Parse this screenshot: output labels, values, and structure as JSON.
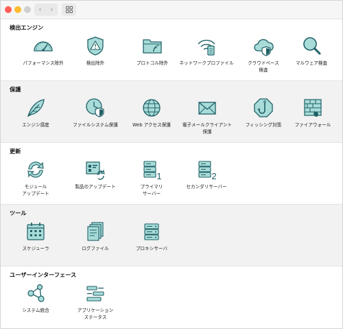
{
  "colors": {
    "icon_fill": "#a9dcd9",
    "icon_stroke": "#1f5f66",
    "section_alt_bg": "#f2f2f2"
  },
  "window": {
    "traffic_lights": [
      "#fe5f57",
      "#febc2e",
      "#d0d0d0"
    ],
    "nav_back": "‹",
    "nav_forward": "›"
  },
  "sections": [
    {
      "title": "検出エンジン",
      "items": [
        {
          "label": "パフォーマンス除外",
          "icon": "gauge-icon"
        },
        {
          "label": "検出除外",
          "icon": "warning-shield-icon"
        },
        {
          "label": "プロトコル除外",
          "icon": "folder-icon"
        },
        {
          "label": "ネットワークプロファイル",
          "icon": "wifi-device-icon"
        },
        {
          "label": "クラウドベース\n検査",
          "icon": "cloud-shield-icon"
        },
        {
          "label": "マルウェア検査",
          "icon": "magnifier-icon"
        }
      ]
    },
    {
      "title": "保護",
      "items": [
        {
          "label": "エンジン感度",
          "icon": "feather-icon"
        },
        {
          "label": "ファイルシステム保護",
          "icon": "clock-shield-icon"
        },
        {
          "label": "Web アクセス保護",
          "icon": "globe-icon"
        },
        {
          "label": "電子メールクライアント\n保護",
          "icon": "envelope-icon"
        },
        {
          "label": "フィッシング対策",
          "icon": "fishhook-icon"
        },
        {
          "label": "ファイアウォール",
          "icon": "firewall-icon"
        }
      ]
    },
    {
      "title": "更新",
      "items": [
        {
          "label": "モジュール\nアップデート",
          "icon": "sync-icon"
        },
        {
          "label": "製品のアップデート",
          "icon": "window-refresh-icon"
        },
        {
          "label": "プライマリ\nサーバー",
          "icon": "server-1-icon",
          "badge": "1"
        },
        {
          "label": "セカンダリサーバー",
          "icon": "server-2-icon",
          "badge": "2"
        }
      ]
    },
    {
      "title": "ツール",
      "items": [
        {
          "label": "スケジューラ",
          "icon": "calendar-icon"
        },
        {
          "label": "ログファイル",
          "icon": "log-files-icon"
        },
        {
          "label": "プロキシサーバ",
          "icon": "proxy-server-icon"
        }
      ]
    },
    {
      "title": "ユーザーインターフェース",
      "items": [
        {
          "label": "システム統合",
          "icon": "nodes-icon"
        },
        {
          "label": "アプリケーション\nステータス",
          "icon": "status-bars-icon"
        }
      ]
    }
  ]
}
